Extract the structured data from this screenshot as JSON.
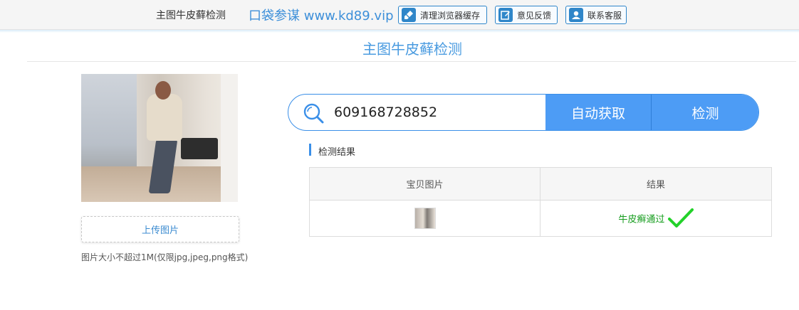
{
  "header": {
    "title": "主图牛皮藓检测",
    "brand": "口袋参谋 www.kd89.vip",
    "buttons": [
      {
        "label": "清理浏览器缓存",
        "icon": "broom-icon"
      },
      {
        "label": "意见反馈",
        "icon": "edit-icon"
      },
      {
        "label": "联系客服",
        "icon": "user-service-icon"
      }
    ]
  },
  "page": {
    "title": "主图牛皮藓检测"
  },
  "upload": {
    "button_label": "上传图片",
    "hint": "图片大小不超过1M(仅限jpg,jpeg,png格式)"
  },
  "search": {
    "value": "609168728852",
    "auto_label": "自动获取",
    "check_label": "检测"
  },
  "results": {
    "section_title": "检测结果",
    "columns": [
      "宝贝图片",
      "结果"
    ],
    "rows": [
      {
        "result": "牛皮癣通过"
      }
    ]
  },
  "colors": {
    "accent": "#4d9cf5",
    "pass": "#159c1d",
    "check": "#23d12a"
  }
}
